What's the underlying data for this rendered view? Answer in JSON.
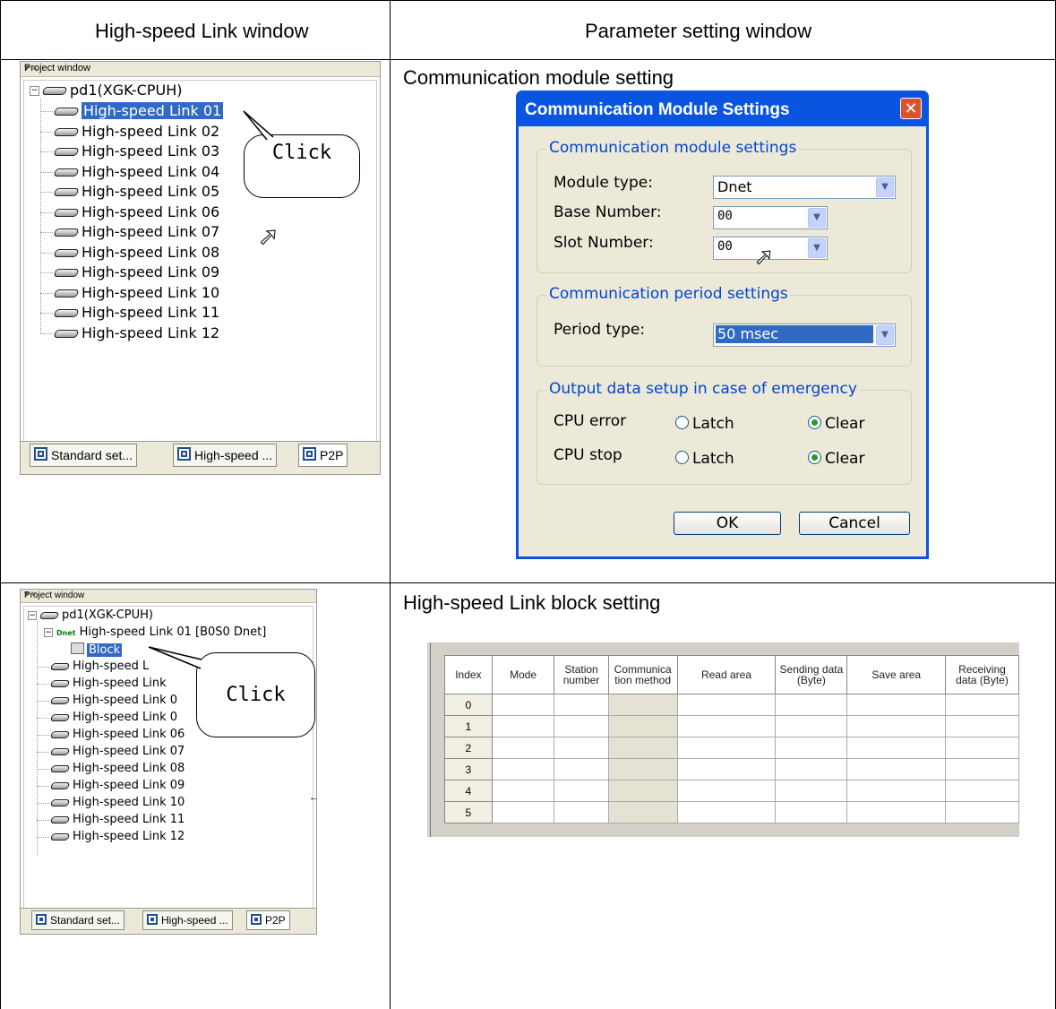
{
  "headers": {
    "left": "High-speed Link window",
    "right": "Parameter setting window"
  },
  "project_window_top": {
    "caption": "Project window",
    "caption_controls": "▾ ×",
    "root": "pd1(XGK-CPUH)",
    "items": [
      "High-speed Link 01",
      "High-speed Link 02",
      "High-speed Link 03",
      "High-speed Link 04",
      "High-speed Link 05",
      "High-speed Link 06",
      "High-speed Link 07",
      "High-speed Link 08",
      "High-speed Link 09",
      "High-speed Link 10",
      "High-speed Link 11",
      "High-speed Link 12"
    ],
    "selected_index": 0,
    "tabs": [
      "Standard set...",
      "High-speed ...",
      "P2P"
    ],
    "callout": "Click"
  },
  "project_window_bottom": {
    "caption": "Project window",
    "caption_controls": "▾ ×",
    "root": "pd1(XGK-CPUH)",
    "expanded_item": "High-speed Link 01 [B0S0 Dnet]",
    "expanded_badge": "Dnet",
    "child": "Block",
    "items": [
      "High-speed L",
      "High-speed Link",
      "High-speed Link 0",
      "High-speed Link 0",
      "High-speed Link 06",
      "High-speed Link 07",
      "High-speed Link 08",
      "High-speed Link 09",
      "High-speed Link 10",
      "High-speed Link 11",
      "High-speed Link 12"
    ],
    "tabs": [
      "Standard set...",
      "High-speed ...",
      "P2P"
    ],
    "callout": "Click"
  },
  "comm_section_title": "Communication module setting",
  "dialog": {
    "title": "Communication Module Settings",
    "close_glyph": "✕",
    "group1": {
      "label": "Communication module settings",
      "module_type_label": "Module type:",
      "module_type_value": "Dnet",
      "base_number_label": "Base Number:",
      "base_number_value": "00",
      "slot_number_label": "Slot Number:",
      "slot_number_value": "00"
    },
    "group2": {
      "label": "Communication period settings",
      "period_type_label": "Period type:",
      "period_type_value": "50 msec"
    },
    "group3": {
      "label": "Output data setup in case of emergency",
      "cpu_error_label": "CPU error",
      "cpu_stop_label": "CPU stop",
      "latch_label": "Latch",
      "clear_label": "Clear"
    },
    "ok_label": "OK",
    "cancel_label": "Cancel"
  },
  "block_section_title": "High-speed Link block setting",
  "block_table": {
    "columns": [
      "Index",
      "Mode",
      "Station number",
      "Communica tion method",
      "Read area",
      "Sending data (Byte)",
      "Save area",
      "Receiving data (Byte)"
    ],
    "rows": [
      "0",
      "1",
      "2",
      "3",
      "4",
      "5"
    ]
  },
  "icons": {
    "hdd": "drive-icon",
    "cursor": "mouse-cursor-icon",
    "dropdown": "chevron-down-icon"
  }
}
